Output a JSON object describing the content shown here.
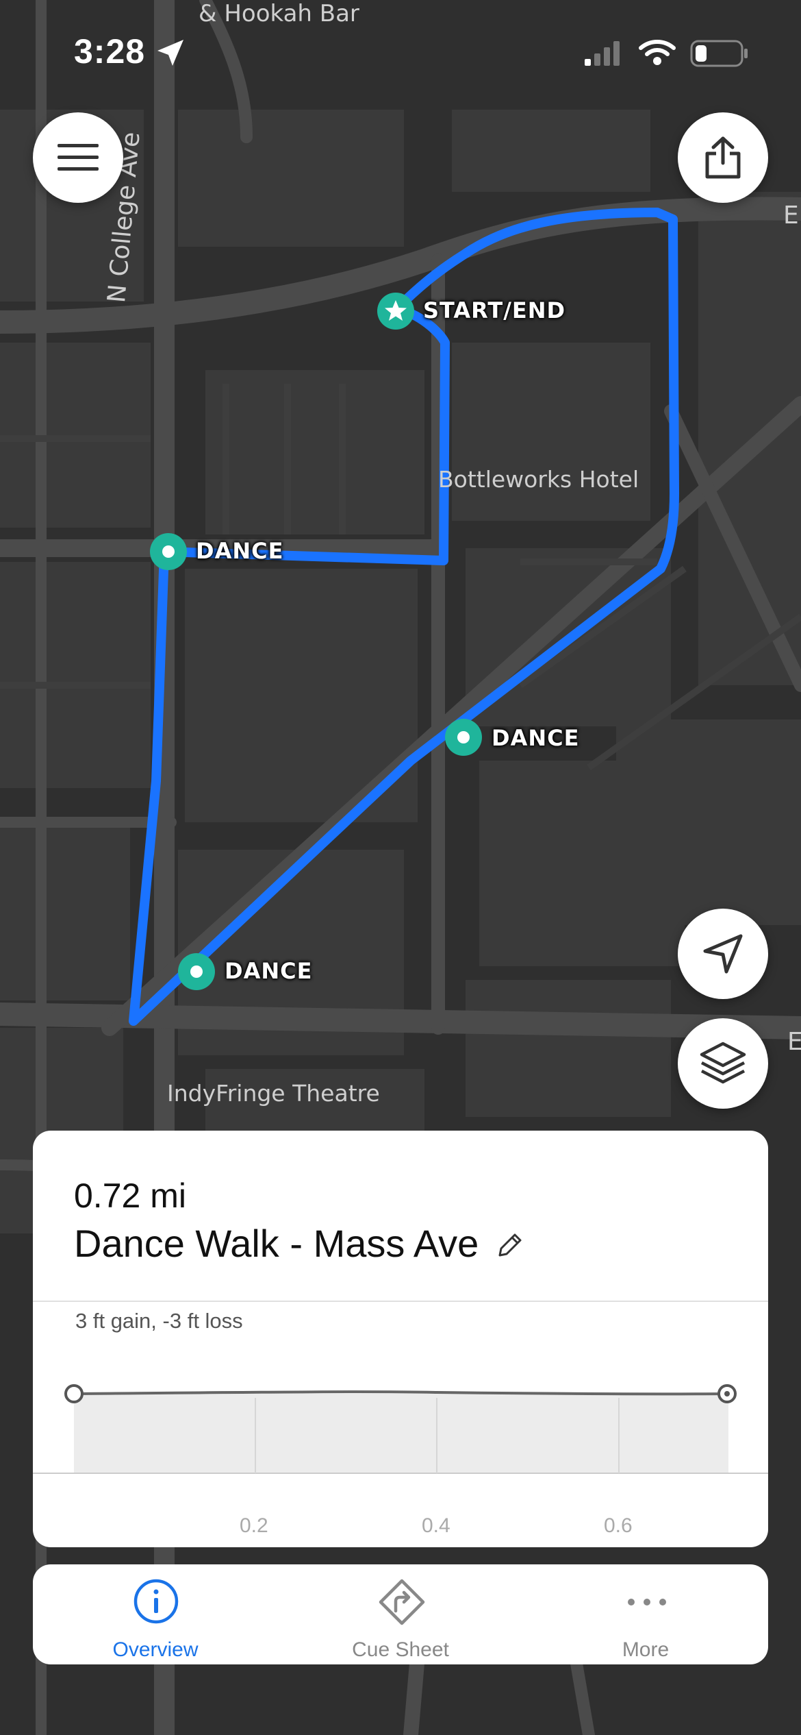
{
  "status_bar": {
    "time": "3:28"
  },
  "map": {
    "labels": {
      "hookah": "& Hookah Bar",
      "street": "N College Ave",
      "hotel": "Bottleworks Hotel",
      "theatre": "IndyFringe Theatre",
      "edge1": "E",
      "edge2": "E"
    },
    "pins": [
      {
        "label": "START/END",
        "type": "star"
      },
      {
        "label": "DANCE",
        "type": "dot"
      },
      {
        "label": "DANCE",
        "type": "dot"
      },
      {
        "label": "DANCE",
        "type": "dot"
      }
    ],
    "route_color": "#1a73ff",
    "pin_color": "#1fb59b"
  },
  "route_card": {
    "distance": "0.72 mi",
    "name": "Dance Walk - Mass Ave",
    "elevation_summary": "3 ft gain, -3 ft loss",
    "x_ticks": [
      "0.2",
      "0.4",
      "0.6"
    ]
  },
  "tabs": [
    {
      "label": "Overview",
      "icon": "info-icon",
      "active": true
    },
    {
      "label": "Cue Sheet",
      "icon": "turn-sign-icon",
      "active": false
    },
    {
      "label": "More",
      "icon": "ellipsis-icon",
      "active": false
    }
  ],
  "colors": {
    "active_tab": "#1a73e8",
    "inactive_tab": "#888888"
  }
}
